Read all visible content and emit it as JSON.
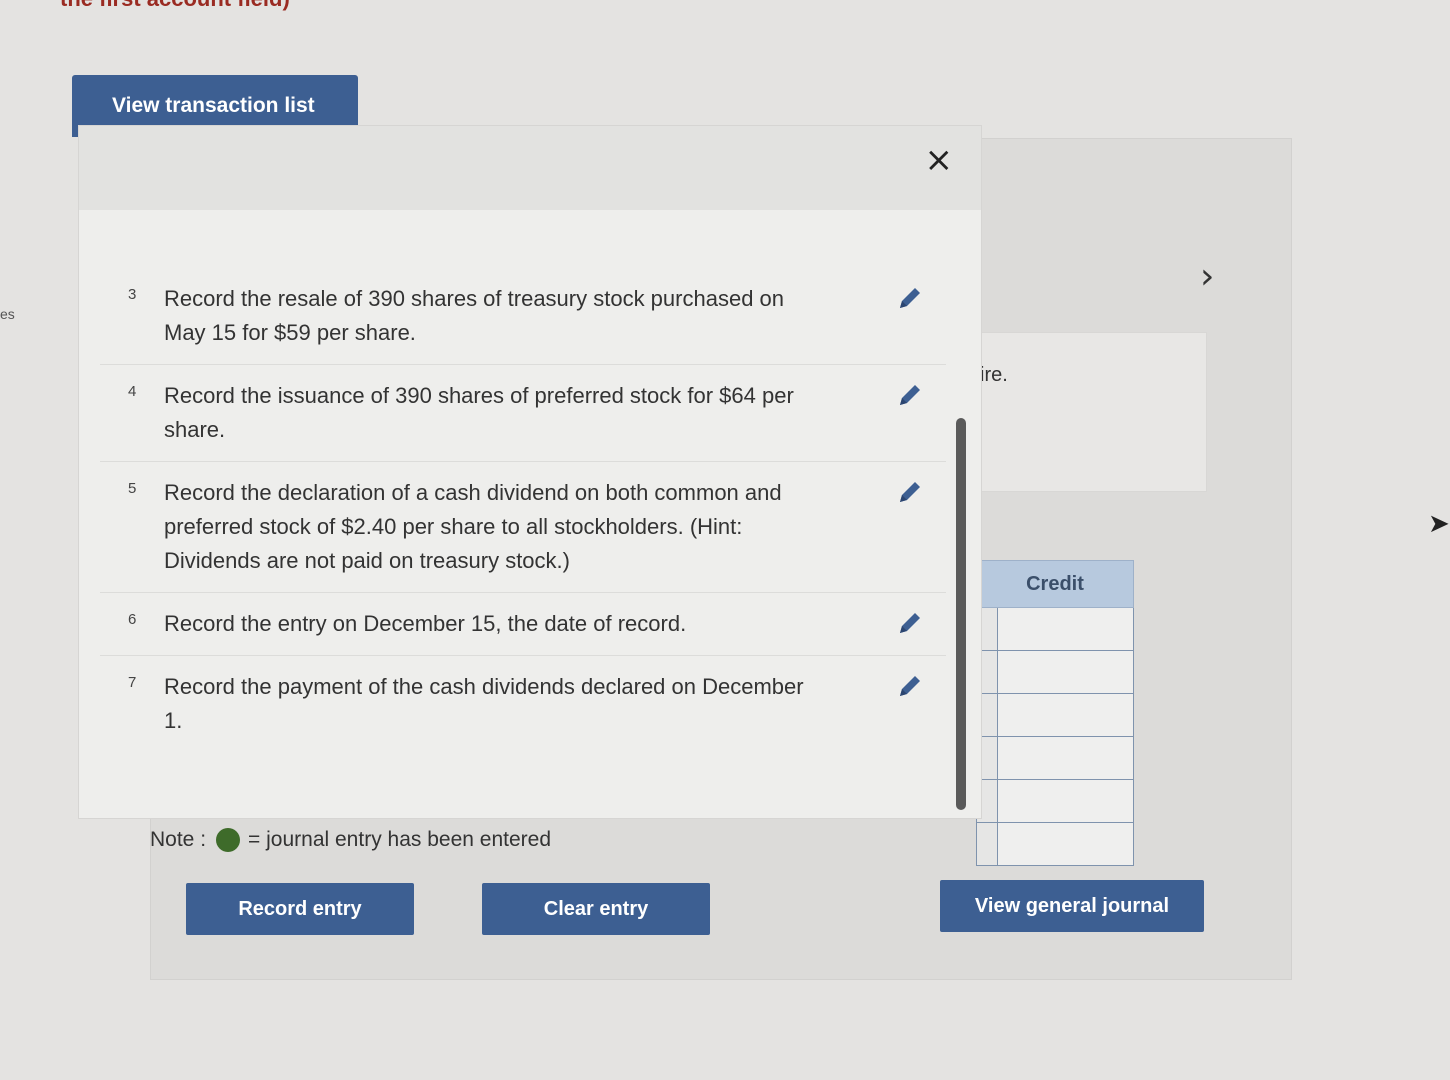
{
  "top_fragment": "the first account field)",
  "side_fragment": "es",
  "view_tab_label": "View transaction list",
  "close_glyph": "×",
  "hint_text": "ire.",
  "next_arrow": "›",
  "transactions": [
    {
      "num": "3",
      "text": "Record the resale of 390 shares of treasury stock purchased on May 15 for $59 per share."
    },
    {
      "num": "4",
      "text": "Record the issuance of 390 shares of preferred stock for $64 per share."
    },
    {
      "num": "5",
      "text": "Record the declaration of a cash dividend on both common and preferred stock of $2.40 per share to all stockholders. (Hint: Dividends are not paid on treasury stock.)"
    },
    {
      "num": "6",
      "text": "Record the entry on December 15, the date of record."
    },
    {
      "num": "7",
      "text": "Record the payment of the cash dividends declared on December 1."
    }
  ],
  "note": {
    "label": "Note :",
    "legend_text": "= journal entry has been entered",
    "dot_color": "#3e6b2a"
  },
  "table": {
    "credit_header": "Credit",
    "row_count": 6
  },
  "buttons": {
    "record": "Record entry",
    "clear": "Clear entry",
    "view_journal": "View general journal"
  },
  "colors": {
    "accent": "#3d5f92",
    "header_fill": "#b7c9de"
  },
  "icons": {
    "edit": "pencil-icon",
    "close": "close-icon",
    "next": "chevron-right-icon"
  }
}
